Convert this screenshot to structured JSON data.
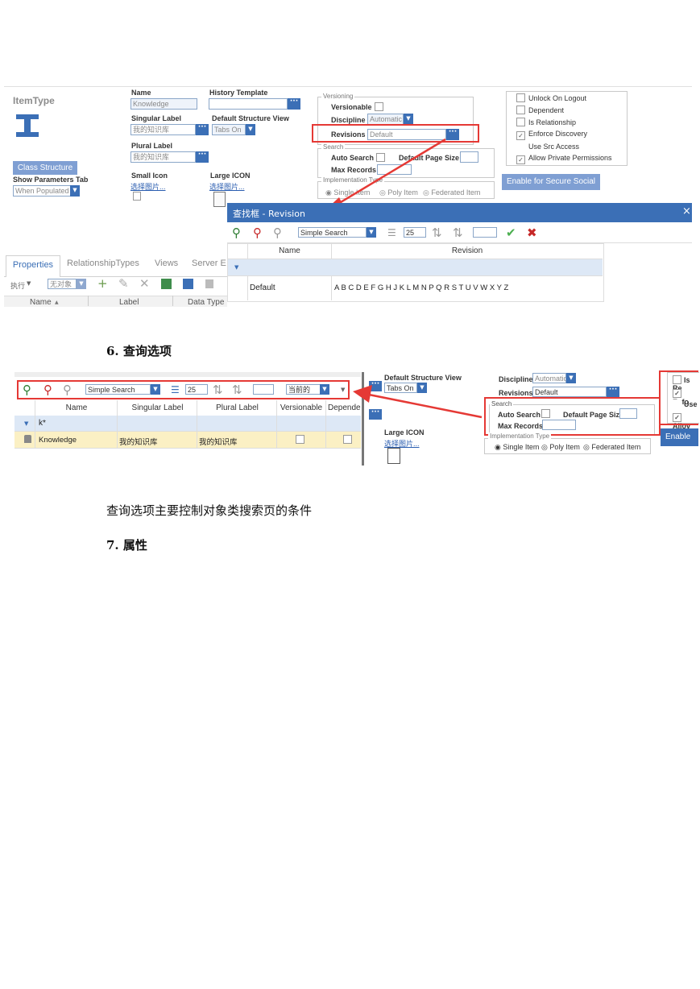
{
  "shot1": {
    "itemtype_label": "ItemType",
    "name_label": "Name",
    "name_value": "Knowledge",
    "singular_label": "Singular Label",
    "singular_value": "我的知识库",
    "plural_label": "Plural Label",
    "plural_value": "我的知识库",
    "small_icon_label": "Small Icon",
    "small_icon_link": "选择图片...",
    "large_icon_label": "Large ICON",
    "large_icon_link": "选择图片...",
    "history_template_label": "History Template",
    "default_structure_view_label": "Default Structure View",
    "default_structure_view_value": "Tabs On",
    "class_structure_button": "Class Structure",
    "show_parameters_tab_label": "Show Parameters Tab",
    "show_parameters_tab_value": "When Populated",
    "versioning_legend": "Versioning",
    "versionable_label": "Versionable",
    "discipline_label": "Discipline",
    "discipline_value": "Automatic",
    "revisions_label": "Revisions",
    "revisions_value": "Default",
    "search_legend": "Search",
    "auto_search_label": "Auto Search",
    "default_page_size_label": "Default Page Size",
    "max_records_label": "Max Records",
    "impl_type_legend": "Implementation Type",
    "impl_single": "Single Item",
    "impl_poly": "Poly Item",
    "impl_federated": "Federated Item",
    "options": [
      {
        "label": "Unlock On Logout",
        "checked": false
      },
      {
        "label": "Dependent",
        "checked": false
      },
      {
        "label": "Is Relationship",
        "checked": false
      },
      {
        "label": "Enforce Discovery",
        "checked": true
      },
      {
        "label": "Use Src Access",
        "checked": false
      },
      {
        "label": "Allow Private Permissions",
        "checked": true
      }
    ],
    "secure_social_button": "Enable for Secure Social",
    "tabs": [
      "Properties",
      "RelationshipTypes",
      "Views",
      "Server E"
    ],
    "execute_label": "执行",
    "no_object_value": "无对象",
    "col_name": "Name",
    "col_label": "Label",
    "col_datatype": "Data Type",
    "dialog": {
      "title": "查找框 - Revision",
      "close": "×",
      "search_mode": "Simple Search",
      "page_size": "25",
      "col_name": "Name",
      "col_revision": "Revision",
      "row_name": "Default",
      "row_revision": "A B C D E F G H J K L M N P Q R S T U V W X Y Z"
    }
  },
  "section6_heading": "6. 查询选项",
  "shot2": {
    "search_mode": "Simple Search",
    "page_size": "25",
    "current_value": "当前的",
    "columns": [
      "Name",
      "Singular Label",
      "Plural Label",
      "Versionable",
      "Depende"
    ],
    "filter_value": "k*",
    "row": {
      "name": "Knowledge",
      "singular": "我的知识库",
      "plural": "我的知识库"
    },
    "default_structure_view_label": "Default Structure View",
    "default_structure_view_value": "Tabs On",
    "large_icon_label": "Large ICON",
    "large_icon_link": "选择图片...",
    "discipline_label": "Discipline",
    "discipline_value": "Automatic",
    "revisions_label": "Revisions",
    "revisions_value": "Default",
    "search_legend": "Search",
    "auto_search_label": "Auto Search",
    "default_page_size_label": "Default Page Size",
    "max_records_label": "Max Records",
    "impl_type_legend": "Implementation Type",
    "impl_single": "Single Item",
    "impl_poly": "Poly Item",
    "impl_federated": "Federated Item",
    "right_options": [
      "Is Re",
      "Enfo",
      "Use",
      "Allov"
    ],
    "enable_button": "Enable fo"
  },
  "section6_paragraph": "查询选项主要控制对象类搜索页的条件",
  "section7_heading": "7. 属性",
  "colors": {
    "accent": "#3b6fb6",
    "highlight": "#e53935",
    "row_yellow": "#fbf0c4",
    "header_blue": "#dde8f6"
  }
}
